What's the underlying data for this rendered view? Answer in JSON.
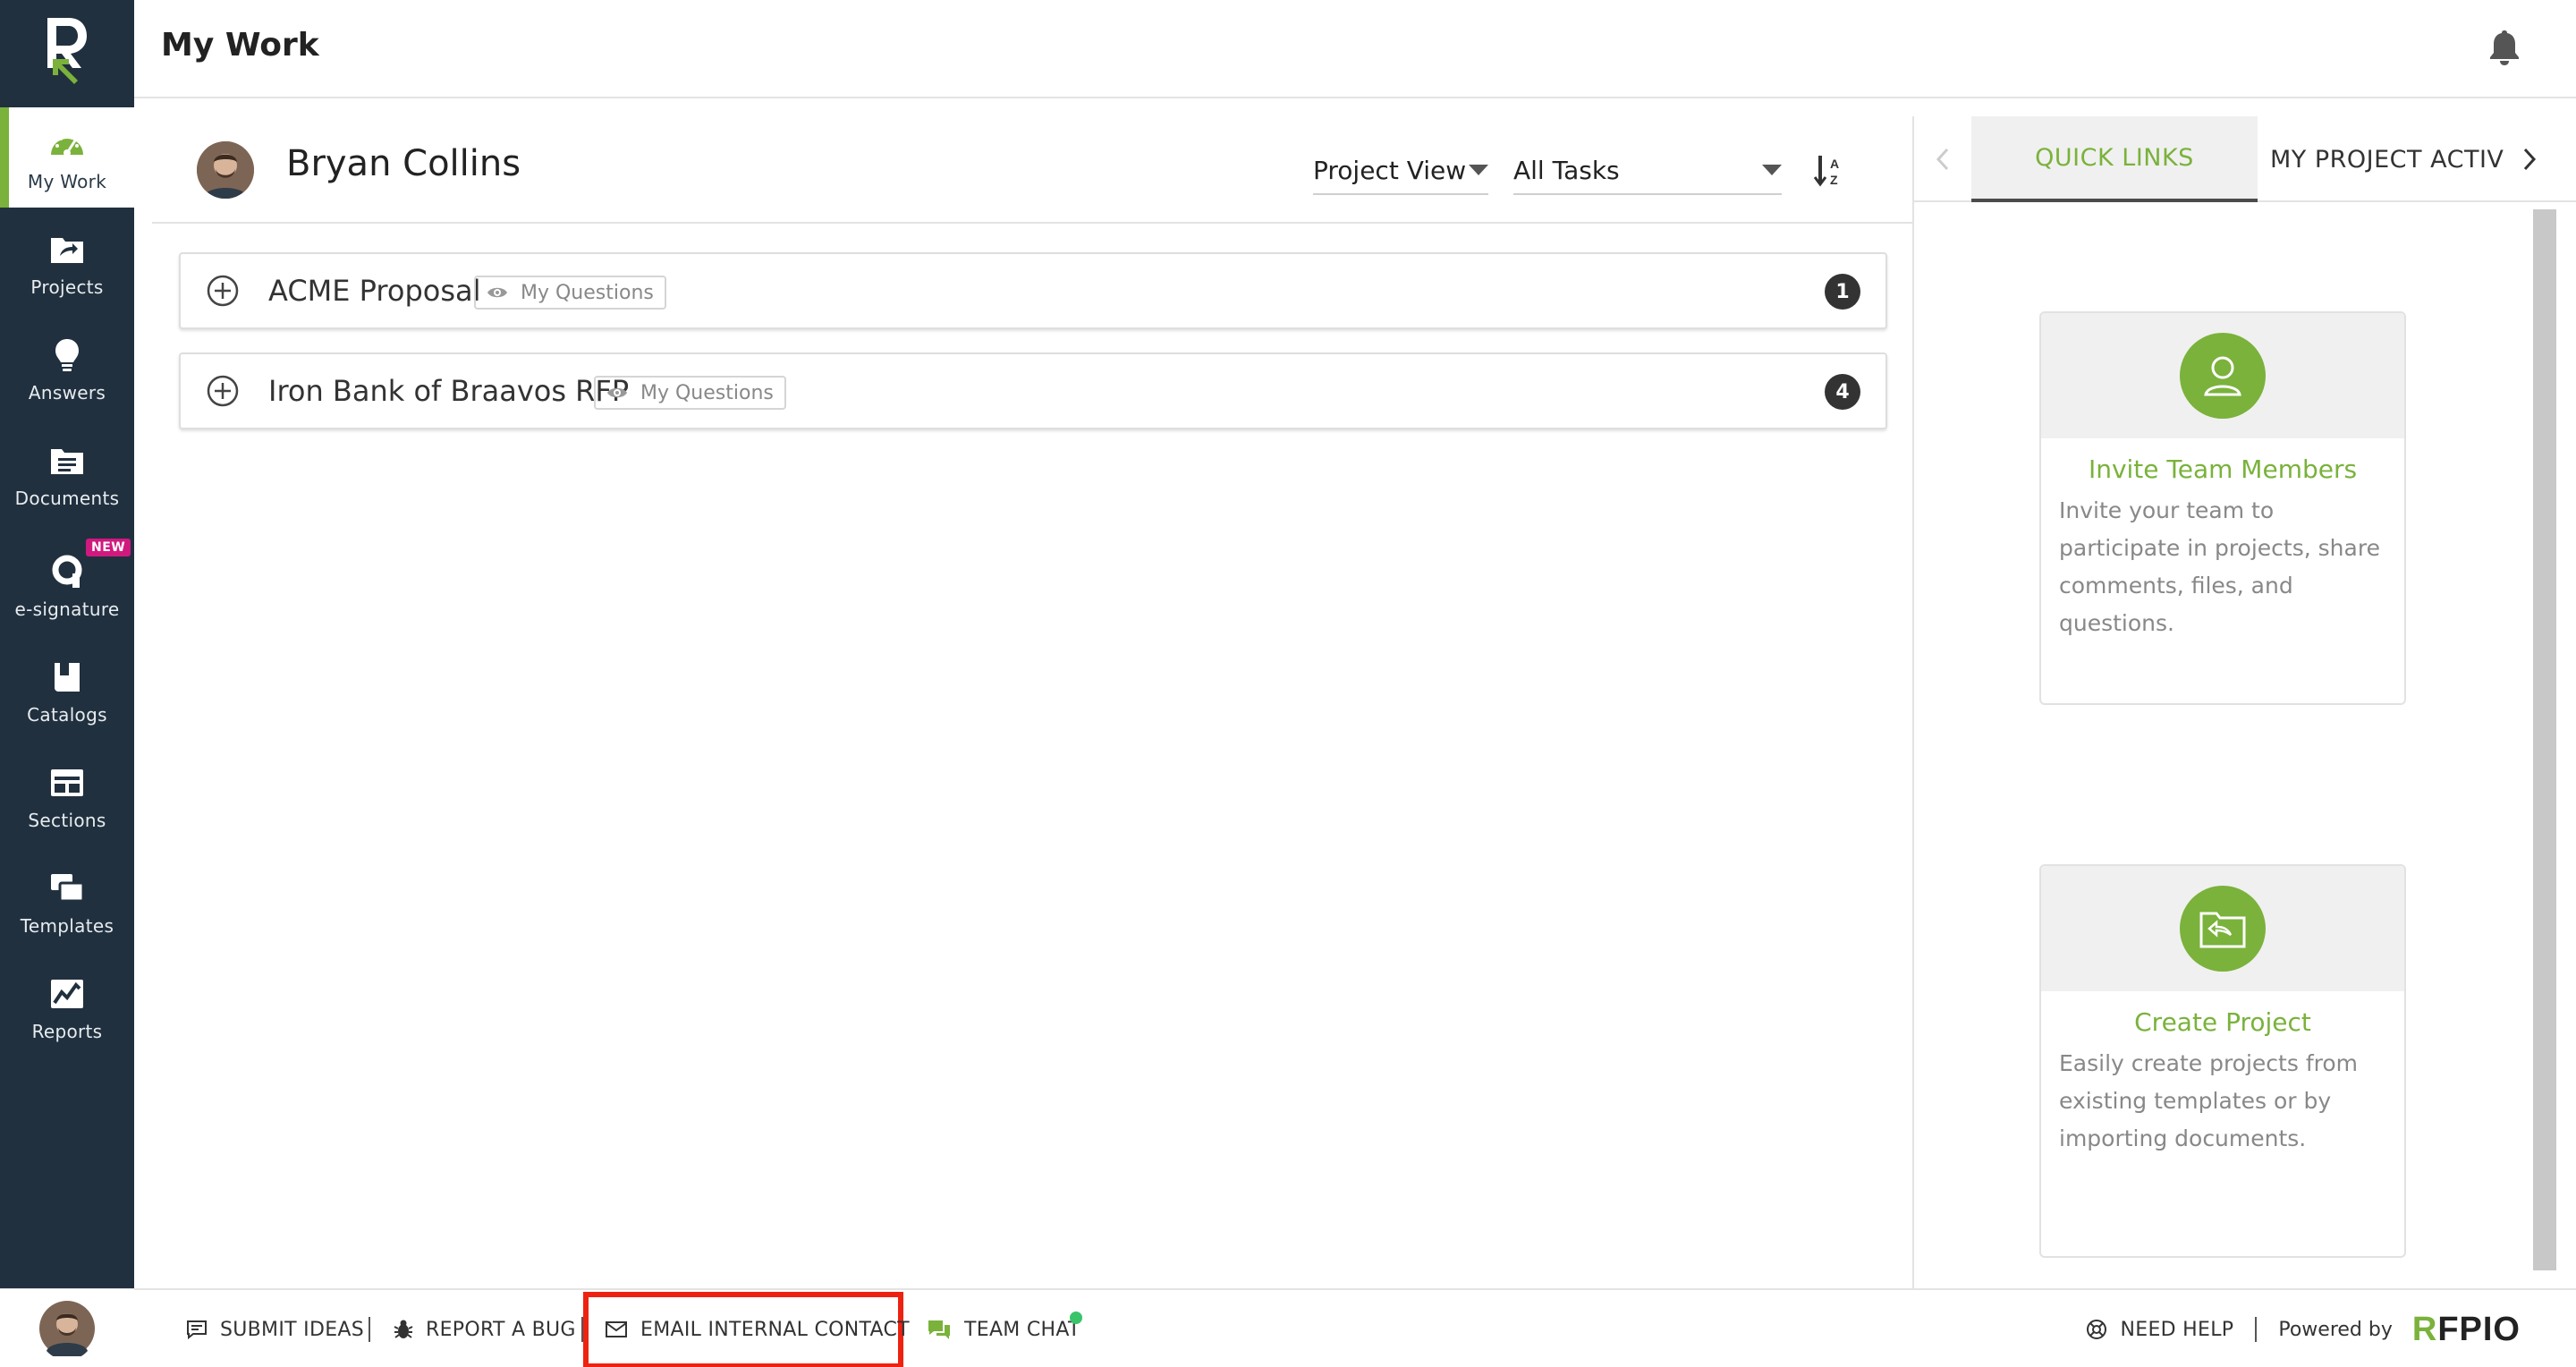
{
  "header": {
    "title": "My Work"
  },
  "sidebar": {
    "items": [
      {
        "label": "My Work",
        "icon": "dashboard-gauge-icon",
        "active": true
      },
      {
        "label": "Projects",
        "icon": "folder-share-icon"
      },
      {
        "label": "Answers",
        "icon": "lightbulb-icon"
      },
      {
        "label": "Documents",
        "icon": "documents-icon"
      },
      {
        "label": "e-signature",
        "icon": "esignature-icon",
        "badge": "NEW"
      },
      {
        "label": "Catalogs",
        "icon": "catalog-book-icon"
      },
      {
        "label": "Sections",
        "icon": "sections-icon"
      },
      {
        "label": "Templates",
        "icon": "templates-icon"
      },
      {
        "label": "Reports",
        "icon": "reports-chart-icon"
      }
    ]
  },
  "main": {
    "user_name": "Bryan Collins",
    "view_select": "Project View",
    "task_filter": "All Tasks",
    "projects": [
      {
        "name": "ACME Proposal",
        "tag": "My Questions",
        "count": "1"
      },
      {
        "name": "Iron Bank of Braavos RFP",
        "tag": "My Questions",
        "count": "4"
      }
    ]
  },
  "right_panel": {
    "tabs": [
      "QUICK LINKS",
      "MY PROJECT ACTIVITI"
    ],
    "cards": [
      {
        "title": "Invite Team Members",
        "description": "Invite your team to participate in projects, share comments, files, and questions.",
        "icon": "user-icon"
      },
      {
        "title": "Create Project",
        "description": "Easily create projects from existing templates or by importing documents.",
        "icon": "folder-import-icon"
      }
    ]
  },
  "footer": {
    "submit_ideas": "SUBMIT IDEAS",
    "report_bug": "REPORT A BUG",
    "email_contact": "EMAIL INTERNAL CONTACT",
    "team_chat": "TEAM CHAT",
    "need_help": "NEED HELP",
    "powered_by": "Powered by",
    "brand_r": "R",
    "brand_rest": "FPIO"
  },
  "colors": {
    "sidebar_bg": "#21303f",
    "accent_green": "#7ab23b",
    "highlight_red": "#ee2211",
    "new_badge": "#d0197f"
  }
}
